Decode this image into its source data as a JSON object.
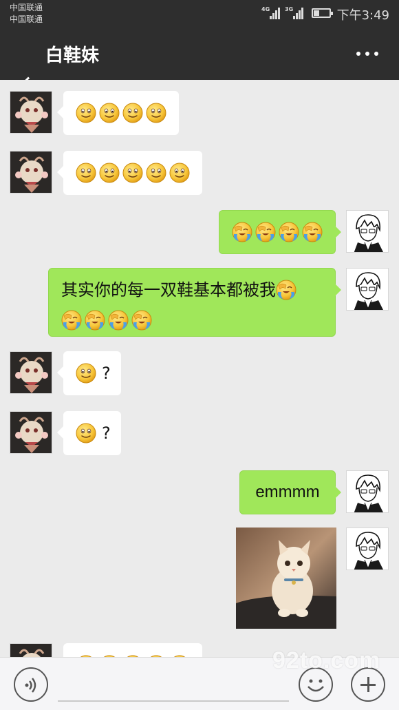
{
  "status_bar": {
    "carrier_1": "中国联通",
    "carrier_2": "中国联通",
    "network_1": "4G",
    "network_2": "3G",
    "battery_level": 0.35,
    "time": "下午3:49"
  },
  "header": {
    "title": "白鞋妹",
    "back_icon": "chevron-left-icon",
    "more_icon": "more-dots-icon"
  },
  "messages": [
    {
      "side": "other",
      "emojis": 4,
      "text": ""
    },
    {
      "side": "other",
      "emojis": 5,
      "text": ""
    },
    {
      "side": "me",
      "emojis": 4,
      "emoji_type": "facepalm",
      "text": ""
    },
    {
      "side": "me",
      "text": "其实你的每一双鞋基本都被我",
      "emojis_after_line1": 1,
      "emojis_line2": 4,
      "emoji_type": "facepalm"
    },
    {
      "side": "other",
      "emojis": 1,
      "text": "?"
    },
    {
      "side": "other",
      "emojis": 1,
      "text": "?"
    },
    {
      "side": "me",
      "text": "emmmm"
    },
    {
      "side": "me",
      "type": "image",
      "image_subject": "kitten photo"
    },
    {
      "side": "other",
      "emojis": 5,
      "text": ""
    }
  ],
  "input_bar": {
    "voice_icon": "voice-icon",
    "emoji_icon": "emoji-icon",
    "plus_icon": "plus-icon",
    "text_value": ""
  },
  "watermark": "92to.com",
  "colors": {
    "header_bg": "#2e2e2e",
    "chat_bg": "#ebebeb",
    "my_bubble": "#a0e75a",
    "their_bubble": "#ffffff"
  }
}
